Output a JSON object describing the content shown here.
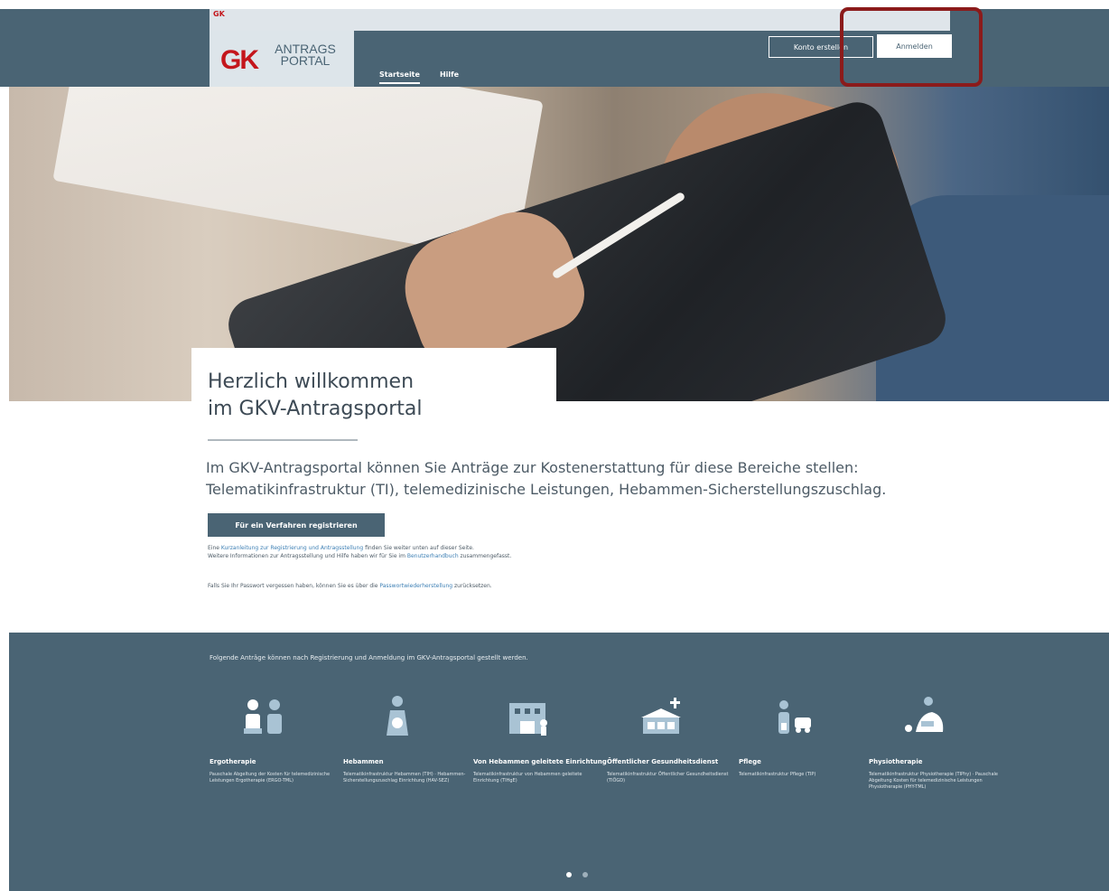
{
  "header": {
    "browserbar_logo": "GK",
    "logo_mark": "GK",
    "logo_line1": "ANTRAGS",
    "logo_line2": "PORTAL",
    "nav": [
      {
        "label": "Startseite",
        "active": true
      },
      {
        "label": "Hilfe",
        "active": false
      }
    ],
    "konto_button": "Konto erstellen",
    "anmelden_button": "Anmelden",
    "highlight_color": "#8b1b1b"
  },
  "hero": {
    "title_line1": "Herzlich willkommen",
    "title_line2": "im GKV-Antragsportal"
  },
  "intro": {
    "lead_line1": "Im GKV-Antragsportal können Sie Anträge zur Kostenerstattung für diese Bereiche stellen:",
    "lead_line2": "Telematikinfrastruktur (TI), telemedizinische Leistungen, Hebammen-Sicherstellungszuschlag.",
    "register_button": "Für ein Verfahren registrieren",
    "info1_pre": "Eine ",
    "info1_link": "Kurzanleitung zur Registrierung und Antragsstellung",
    "info1_post": " finden Sie weiter unten auf dieser Seite.",
    "info2_pre": "Weitere Informationen zur Antragsstellung und Hilfe haben wir für Sie im ",
    "info2_link": "Benutzerhandbuch",
    "info2_post": " zusammengefasst.",
    "info3_pre": "Falls Sie Ihr Passwort vergessen haben, können Sie es über die ",
    "info3_link": "Passwortwiederherstellung",
    "info3_post": " zurücksetzen."
  },
  "footer": {
    "intro": "Folgende Anträge können nach Registrierung und Anmeldung im GKV-Antragsportal gestellt werden.",
    "categories": [
      {
        "title": "Ergotherapie",
        "desc": "Pauschale Abgeltung der Kosten für telemedizinische Leistungen Ergotherapie (ERGO-TML)",
        "icon": "ergotherapie-icon"
      },
      {
        "title": "Hebammen",
        "desc": "Telematikinfrastruktur Hebammen (TIH) · Hebammen-Sicherstellungszuschlag Einrichtung (HAV-SEZ)",
        "icon": "hebammen-icon"
      },
      {
        "title": "Von Hebammen geleitete Einrichtung",
        "desc": "Telematikinfrastruktur von Hebammen geleitete Einrichtung (TIHgE)",
        "icon": "einrichtung-icon"
      },
      {
        "title": "Öffentlicher Gesundheitsdienst",
        "desc": "Telematikinfrastruktur Öffentlicher Gesundheitsdienst (TIÖGD)",
        "icon": "gesundheitsdienst-icon"
      },
      {
        "title": "Pflege",
        "desc": "Telematikinfrastruktur Pflege (TIP)",
        "icon": "pflege-icon"
      },
      {
        "title": "Physiotherapie",
        "desc": "Telematikinfrastruktur Physiotherapie (TIPhy) · Pauschale Abgeltung Kosten für telemedizinische Leistungen Physiotherapie (PHY-TML)",
        "icon": "physiotherapie-icon"
      }
    ]
  }
}
